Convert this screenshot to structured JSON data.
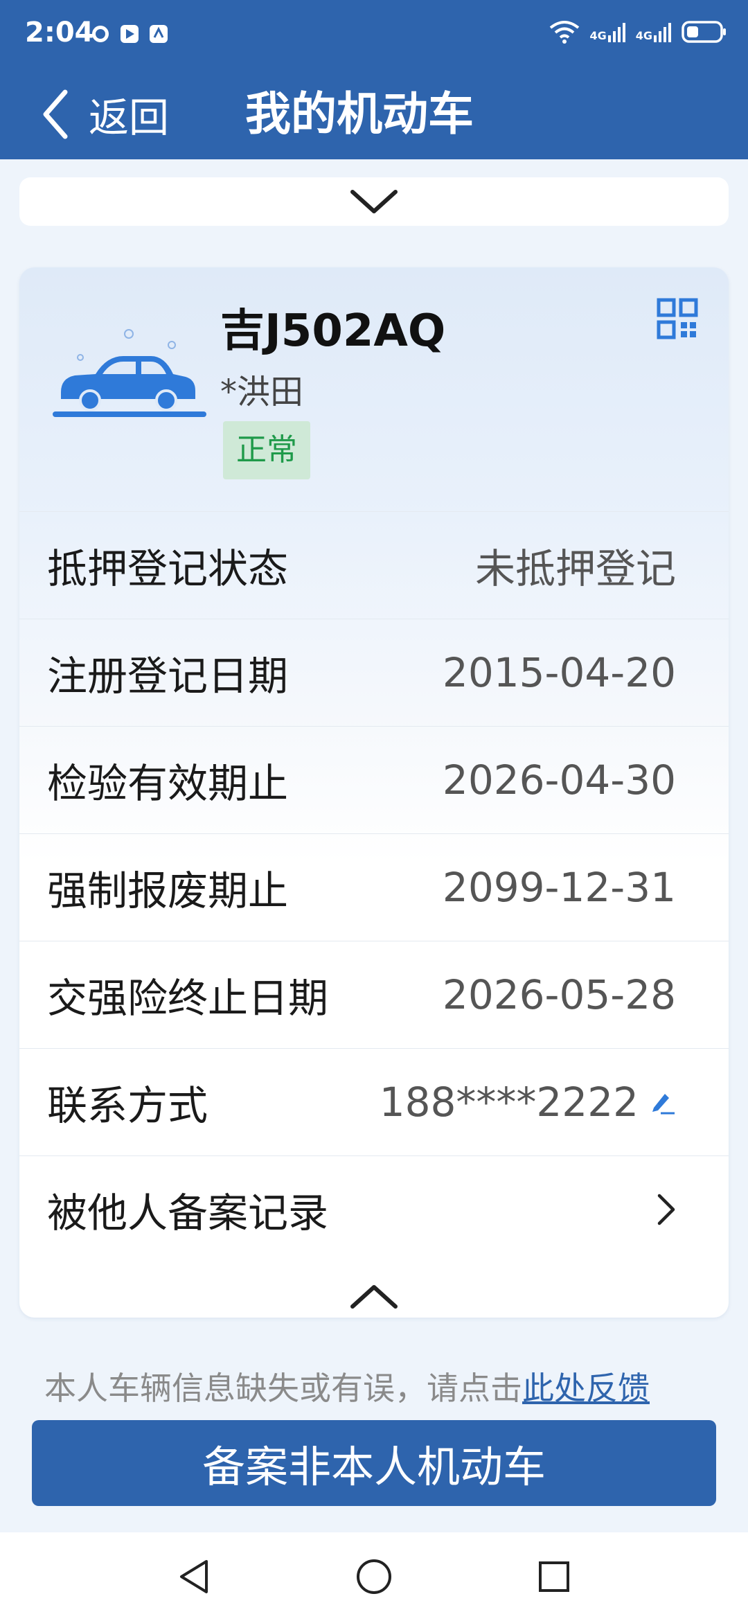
{
  "status_bar": {
    "time": "2:04",
    "network_1": "4G",
    "network_2": "4G",
    "icons": [
      "message-notification-icon",
      "play-store-icon",
      "app-notification-icon",
      "wifi-icon",
      "signal-icon",
      "battery-icon"
    ]
  },
  "header": {
    "back_label": "返回",
    "title": "我的机动车"
  },
  "vehicle": {
    "plate": "吉J502AQ",
    "owner": "*洪田",
    "status": "正常"
  },
  "details": [
    {
      "label": "抵押登记状态",
      "value": "未抵押登记"
    },
    {
      "label": "注册登记日期",
      "value": "2015-04-20"
    },
    {
      "label": "检验有效期止",
      "value": "2026-04-30"
    },
    {
      "label": "强制报废期止",
      "value": "2099-12-31"
    },
    {
      "label": "交强险终止日期",
      "value": "2026-05-28"
    },
    {
      "label": "联系方式",
      "value": "188****2222"
    },
    {
      "label": "被他人备案记录",
      "value": ""
    }
  ],
  "footer": {
    "feedback_text": "本人车辆信息缺失或有误，请点击",
    "feedback_link": "此处反馈",
    "primary_button": "备案非本人机动车"
  },
  "colors": {
    "brand": "#2e64ad",
    "status_ok_bg": "#cfe9d7",
    "status_ok_text": "#1f9a4a",
    "car_blue": "#2f7ad9"
  }
}
